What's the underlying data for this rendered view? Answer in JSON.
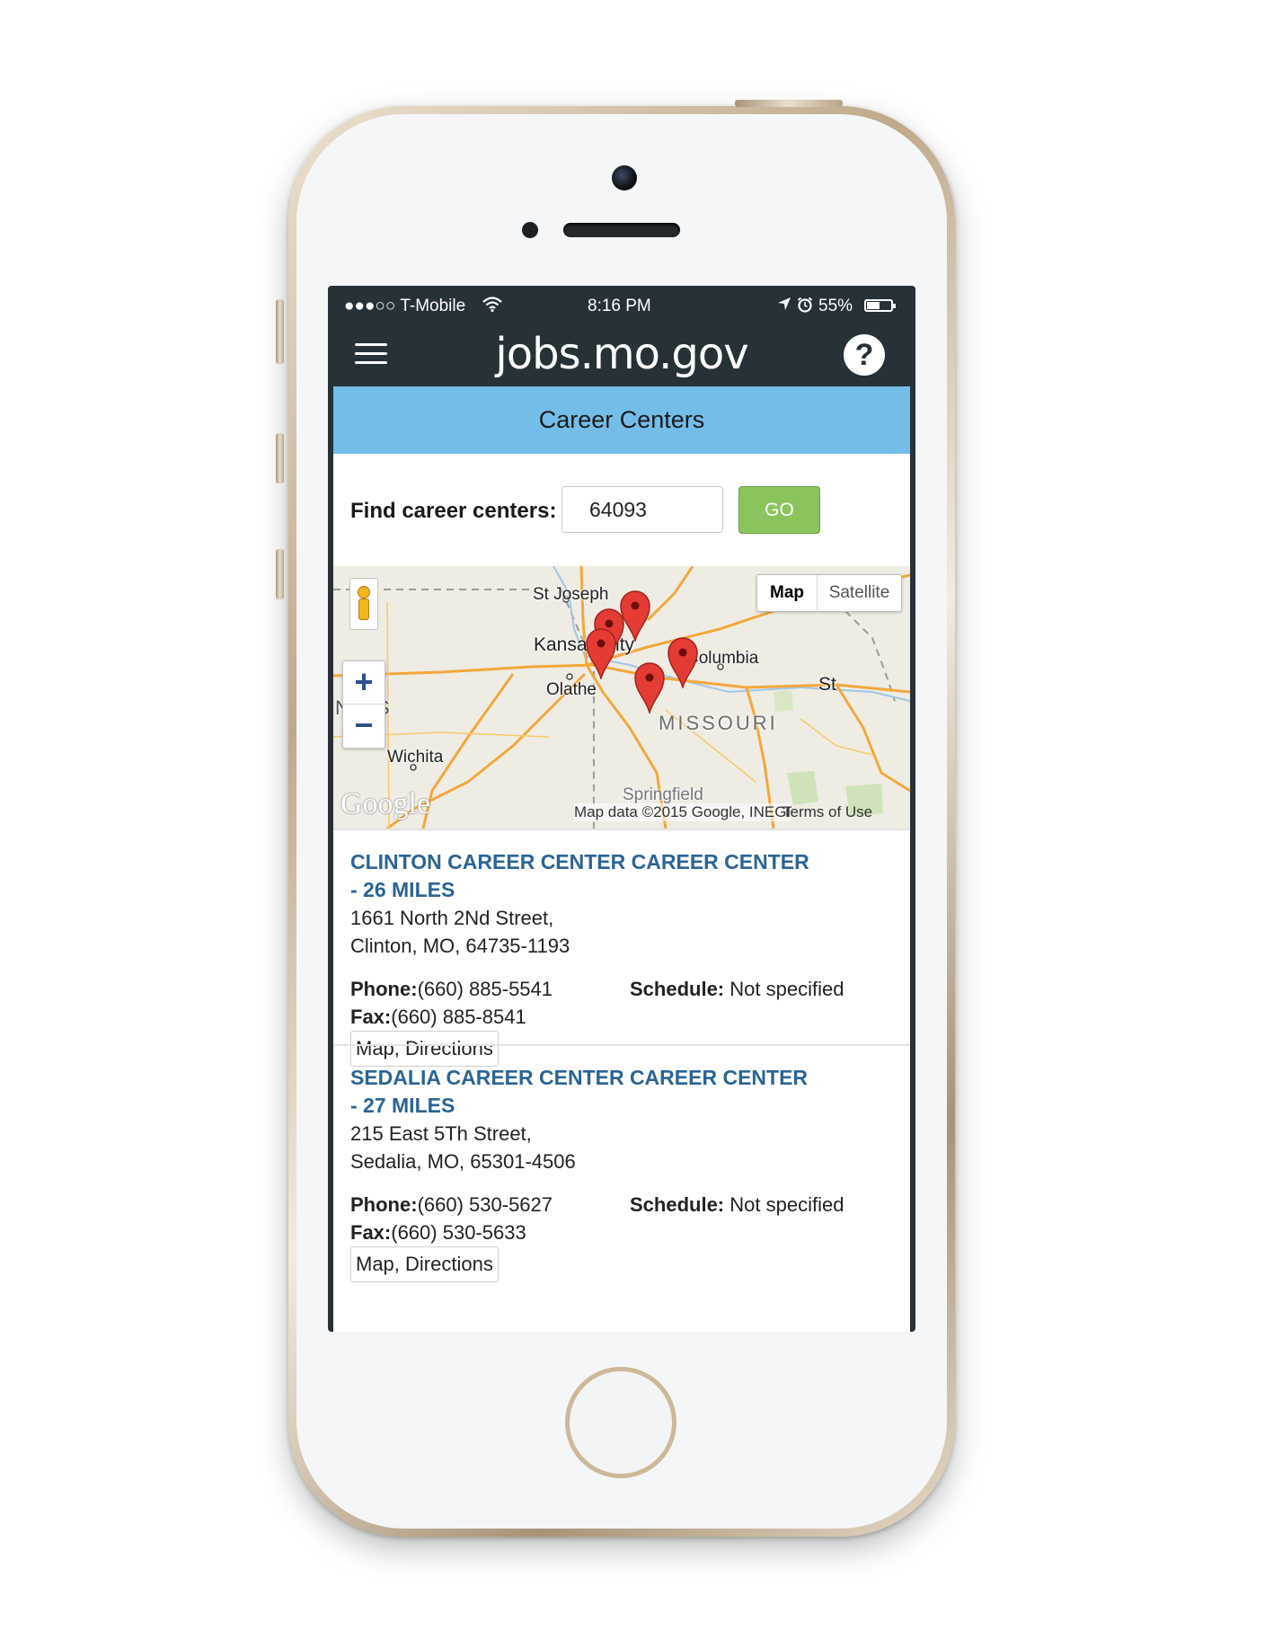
{
  "status_bar": {
    "carrier": "●●●○○ T-Mobile",
    "time": "8:16 PM",
    "battery": "55%",
    "battery_level": 0.55
  },
  "header": {
    "logo": "jobs.mo.gov",
    "help_label": "?"
  },
  "page": {
    "title": "Career Centers"
  },
  "search": {
    "label": "Find career centers:",
    "zip_value": "64093",
    "go_label": "GO"
  },
  "map": {
    "type_buttons": [
      "Map",
      "Satellite"
    ],
    "zoom_in": "+",
    "zoom_out": "−",
    "places": [
      "St Joseph",
      "Kansas City",
      "Olathe",
      "Columbia",
      "Wichita",
      "Springfield",
      "St",
      "MISSOURI",
      "S",
      "N"
    ],
    "logo": "Google",
    "attribution": "Map data ©2015 Google, INEGI",
    "terms": "Terms of Use",
    "marker_color": "#e53b35"
  },
  "results": [
    {
      "title": "Clinton Career Center Career Center - 26 Miles",
      "address_line1": "1661 North 2Nd Street,",
      "address_line2": "Clinton, MO, 64735-1193",
      "phone_label": "Phone:",
      "phone": "(660) 885-5541",
      "fax_label": "Fax:",
      "fax": "(660) 885-8541",
      "schedule_label": "Schedule:",
      "schedule": " Not specified",
      "link": "Map, Directions"
    },
    {
      "title": "Sedalia Career Center Career Center - 27 Miles",
      "address_line1": "215 East 5Th Street,",
      "address_line2": "Sedalia, MO, 65301-4506",
      "phone_label": "Phone:",
      "phone": "(660) 530-5627",
      "fax_label": "Fax:",
      "fax": "(660) 530-5633",
      "schedule_label": "Schedule:",
      "schedule": " Not specified",
      "link": "Map, Directions"
    }
  ],
  "colors": {
    "header_bg": "#263238",
    "banner_bg": "#74bde8",
    "go_button": "#8bc35c",
    "title_link": "#2a6496"
  }
}
